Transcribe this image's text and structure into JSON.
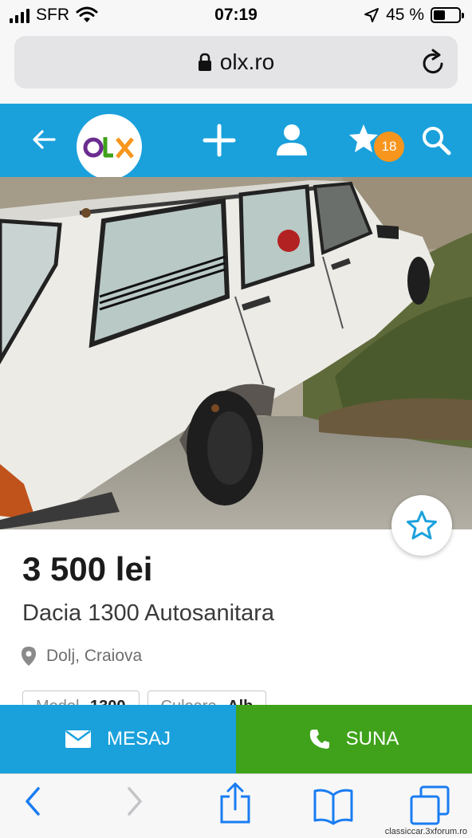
{
  "status_bar": {
    "carrier": "SFR",
    "time": "07:19",
    "battery_percent": "45 %",
    "battery_level": 0.45,
    "signal_icon": "cellular-signal-icon",
    "wifi_icon": "wifi-icon",
    "location_icon": "location-arrow-icon"
  },
  "browser": {
    "url": "olx.ro",
    "lock_icon": "lock-icon",
    "reload_icon": "reload-icon"
  },
  "header": {
    "brand": "OLX",
    "favorites_count": "18",
    "icons": [
      "back-arrow-icon",
      "plus-icon",
      "user-icon",
      "star-icon",
      "search-icon"
    ]
  },
  "listing": {
    "price": "3 500 lei",
    "title": "Dacia 1300 Autosanitara",
    "location": "Dolj, Craiova",
    "attributes": [
      {
        "label": "Model",
        "value": "1300"
      },
      {
        "label": "Culoare",
        "value": "Alb"
      }
    ]
  },
  "actions": {
    "message_label": "MESAJ",
    "call_label": "SUNA"
  },
  "watermark": "classiccar.3xforum.ro",
  "colors": {
    "olx_blue": "#1aa1dc",
    "call_green": "#3fa21a",
    "badge_orange": "#f7951d",
    "ios_blue": "#1a7cf2"
  }
}
